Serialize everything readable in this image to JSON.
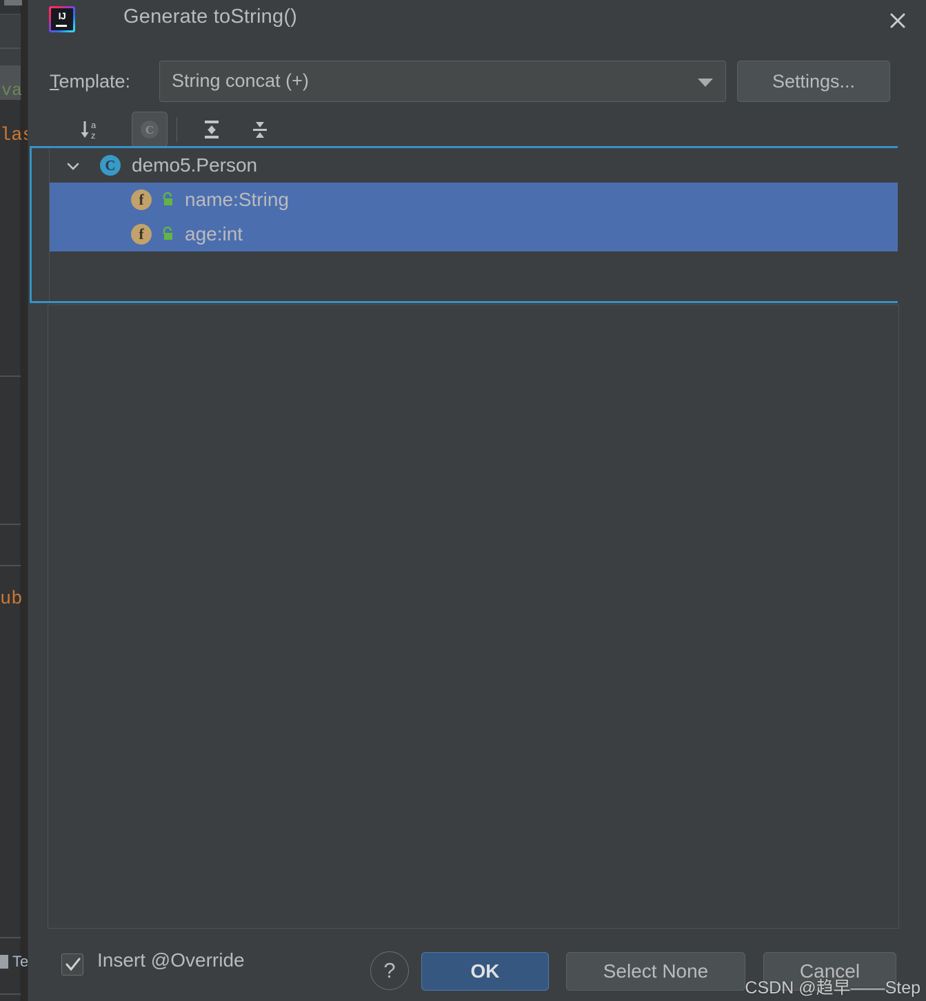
{
  "background": {
    "tab_text": "va",
    "code_text_1": "las",
    "code_text_2": "ub",
    "toolwindow_tab": "Te"
  },
  "dialog": {
    "title": "Generate toString()",
    "app_icon_text": "IJ",
    "close_icon": "close-icon"
  },
  "template": {
    "label_mnemonic": "T",
    "label_rest": "emplate:",
    "selected": "String concat (+)",
    "dropdown_icon": "chevron-down-icon",
    "settings_label": "Settings..."
  },
  "toolbar": {
    "buttons": [
      {
        "name": "sort-alphabetically-button",
        "icon": "sort-az-icon",
        "pressed": false
      },
      {
        "name": "group-by-class-button",
        "icon": "class-circle-icon",
        "label": "C",
        "pressed": true
      },
      {
        "name": "expand-all-button",
        "icon": "expand-all-icon",
        "pressed": false
      },
      {
        "name": "collapse-all-button",
        "icon": "collapse-all-icon",
        "pressed": false
      }
    ]
  },
  "tree": {
    "class_node": {
      "label": "demo5.Person",
      "icon": "class-icon",
      "icon_letter": "C",
      "expanded": true,
      "chevron": "chevron-down-icon"
    },
    "members": [
      {
        "label": "name:String",
        "icon": "field-icon",
        "icon_letter": "f",
        "visibility_icon": "private-lock-icon",
        "selected": true
      },
      {
        "label": "age:int",
        "icon": "field-icon",
        "icon_letter": "f",
        "visibility_icon": "private-lock-icon",
        "selected": true
      }
    ]
  },
  "footer": {
    "insert_override_label": "Insert @Override",
    "insert_override_checked": true,
    "help_label": "?",
    "ok_label": "OK",
    "select_none_label": "Select None",
    "cancel_label": "Cancel"
  },
  "watermark": {
    "text": "CSDN @趋早——Step"
  },
  "colors": {
    "dialog_bg": "#3c3f41",
    "accent_focus": "#3592c4",
    "selection": "#4b6eaf",
    "default_button": "#365880",
    "class_icon": "#389ac7",
    "field_icon": "#c2a26a",
    "lock_icon": "#62b543",
    "text": "#bbbbbb"
  }
}
